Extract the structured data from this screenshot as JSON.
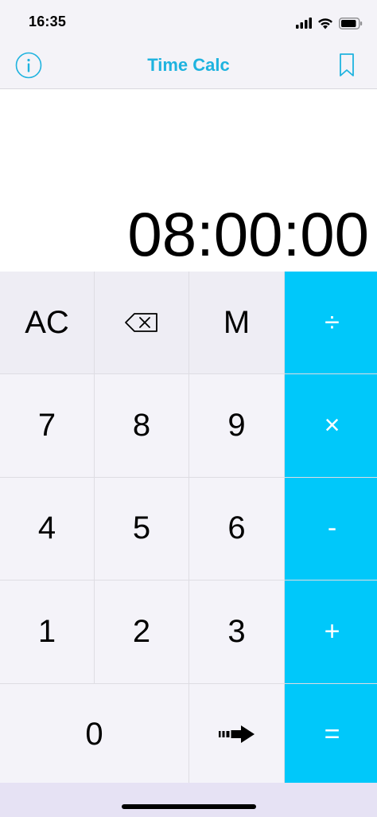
{
  "status_bar": {
    "time": "16:35",
    "icons": [
      "cellular-signal-icon",
      "wifi-icon",
      "battery-icon"
    ]
  },
  "nav_bar": {
    "title": "Time Calc",
    "left_icon": "info-icon",
    "right_icon": "bookmark-icon",
    "accent_color": "#1fb3df"
  },
  "display": {
    "value": "08:00:00"
  },
  "keypad": {
    "ac": "AC",
    "backspace": "⌫",
    "memory": "M",
    "divide": "÷",
    "multiply": "×",
    "minus": "-",
    "plus": "+",
    "equals": "=",
    "digits": {
      "d0": "0",
      "d1": "1",
      "d2": "2",
      "d3": "3",
      "d4": "4",
      "d5": "5",
      "d6": "6",
      "d7": "7",
      "d8": "8",
      "d9": "9"
    },
    "convert_icon": "arrow-right-icon",
    "operator_color": "#00c8fa"
  }
}
